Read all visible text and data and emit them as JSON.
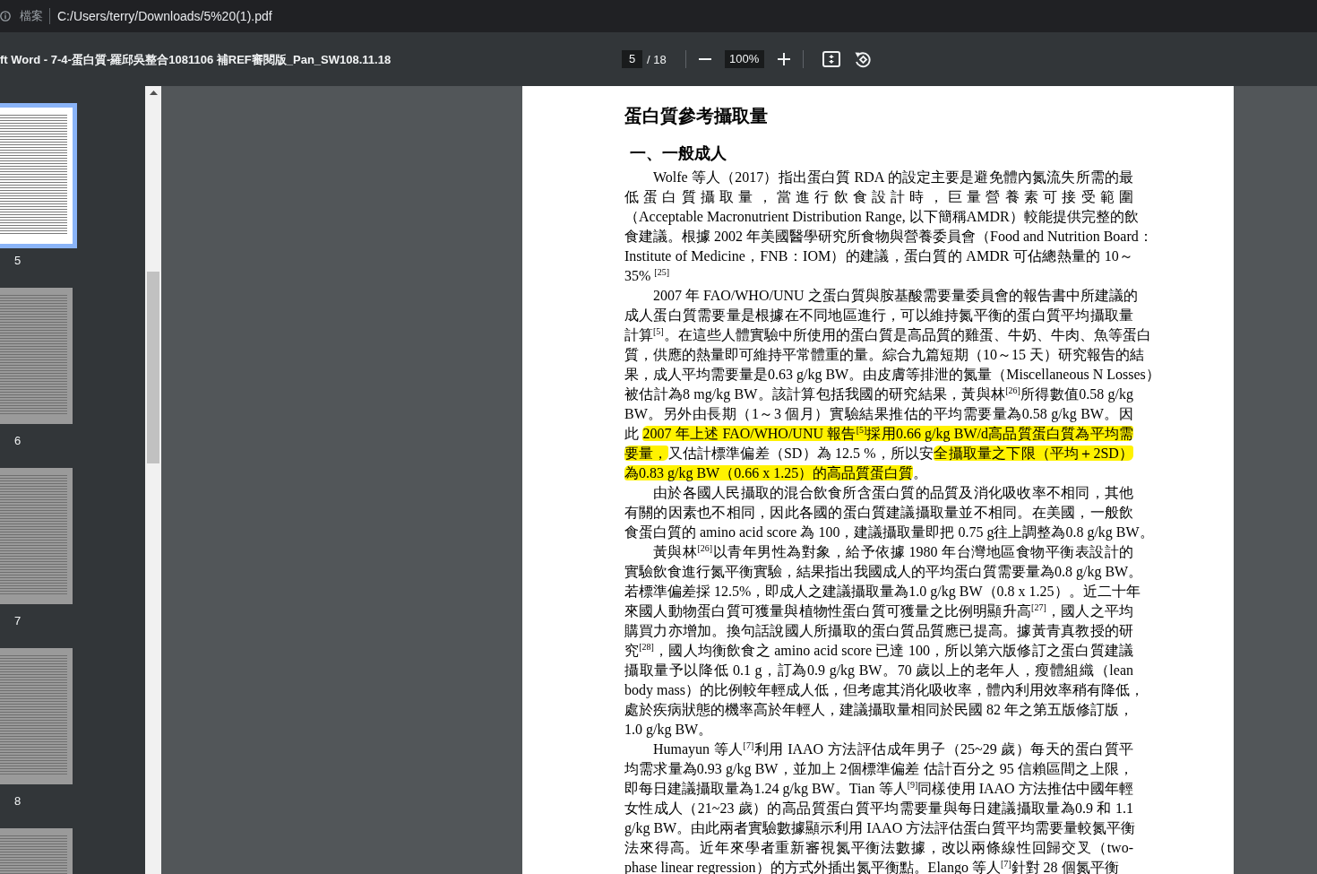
{
  "address_bar": {
    "scheme_label": "檔案",
    "url": "C:/Users/terry/Downloads/5%20(1).pdf"
  },
  "toolbar": {
    "title": "ft Word - 7-4-蛋白質-羅邱吳整合1081106 補REF審閱版_Pan_SW108.11.18",
    "page_number": "5",
    "page_total": "/ 18",
    "zoom": "100%"
  },
  "thumbnails": [
    {
      "label": "5",
      "selected": true
    },
    {
      "label": "6",
      "selected": false
    },
    {
      "label": "7",
      "selected": false
    },
    {
      "label": "8",
      "selected": false
    },
    {
      "selected": false
    }
  ],
  "document": {
    "title": "蛋白質參考攝取量",
    "heading": "一、一般成人",
    "paragraphs": [
      {
        "lines": [
          [
            {
              "text": "Wolfe 等人（2017）指出蛋白質 RDA 的設定主要是避免體內氮流失所需的最",
              "highlighted": false
            }
          ],
          [
            {
              "text": "低蛋白質攝取量，當進行飲食設計時，巨量營養素可接受範圍",
              "highlighted": false
            }
          ],
          [
            {
              "text": "（Acceptable Macronutrient Distribution Range, 以下簡稱AMDR）較能提供完整的飲",
              "highlighted": false
            }
          ],
          [
            {
              "text": "食建議。根據 2002 年美國醫學研究所食物與營養委員會（Food and Nutrition Board：",
              "highlighted": false
            }
          ],
          [
            {
              "text": "Institute of Medicine，FNB：IOM）的建議，蛋白質的 AMDR 可佔總熱量的 10～",
              "highlighted": false
            }
          ],
          [
            {
              "text": "35% $^{[25]}$",
              "highlighted": false
            }
          ]
        ]
      },
      {
        "lines": [
          [
            {
              "text": "2007 年 FAO/WHO/UNU 之蛋白質與胺基酸需要量委員會的報告書中所建議的",
              "highlighted": false
            }
          ],
          [
            {
              "text": "成人蛋白質需要量是根據在不同地區進行，可以維持氮平衡的蛋白質平均攝取量",
              "highlighted": false
            }
          ],
          [
            {
              "text": "計算$^{[5]}$。在這些人體實驗中所使用的蛋白質是高品質的雞蛋、牛奶、牛肉、魚等蛋白",
              "highlighted": false
            }
          ],
          [
            {
              "text": "質，供應的熱量即可維持平常體重的量。綜合九篇短期（10～15 天）研究報告的結",
              "highlighted": false
            }
          ],
          [
            {
              "text": "果，成人平均需要量是0.63 g/kg BW。由皮膚等排泄的氮量（Miscellaneous N Losses）",
              "highlighted": false
            }
          ],
          [
            {
              "text": "被估計為8 mg/kg BW。該計算包括我國的研究結果，黃與林$^{[26]}$所得數值0.58 g/kg",
              "highlighted": false
            }
          ],
          [
            {
              "text": "BW。另外由長期（1～3 個月）實驗結果推估的平均需要量為0.58 g/kg BW。因",
              "highlighted": false
            }
          ],
          [
            {
              "text": "此 ",
              "highlighted": false
            },
            {
              "text": "2007 年上述 FAO/WHO/UNU 報告$^{[5]}$採用0.66 g/kg BW/d高品質蛋白質為平均需",
              "highlighted": true
            }
          ],
          [
            {
              "text": "要量，",
              "highlighted": true
            },
            {
              "text": "又估計標準偏差（SD）為 12.5 %，所以安",
              "highlighted": false
            },
            {
              "text": "全攝取量之下限（平均＋2SD）",
              "highlighted": true
            }
          ],
          [
            {
              "text": "為0.83 g/kg BW（0.66 x 1.25）的高品質蛋白質",
              "highlighted": true
            },
            {
              "text": "。",
              "highlighted": false
            }
          ]
        ]
      },
      {
        "lines": [
          [
            {
              "text": "由於各國人民攝取的混合飲食所含蛋白質的品質及消化吸收率不相同，其他",
              "highlighted": false
            }
          ],
          [
            {
              "text": "有關的因素也不相同，因此各國的蛋白質建議攝取量並不相同。在美國，一般飲",
              "highlighted": false
            }
          ],
          [
            {
              "text": "食蛋白質的 amino acid score 為 100，建議攝取量即把 0.75 g往上調整為0.8 g/kg BW。",
              "highlighted": false
            }
          ]
        ]
      },
      {
        "lines": [
          [
            {
              "text": "黃與林$^{[26]}$以青年男性為對象，給予依據 1980 年台灣地區食物平衡表設計的",
              "highlighted": false
            }
          ],
          [
            {
              "text": "實驗飲食進行氮平衡實驗，結果指出我國成人的平均蛋白質需要量為0.8 g/kg BW。",
              "highlighted": false
            }
          ],
          [
            {
              "text": "若標準偏差採 12.5%，即成人之建議攝取量為1.0 g/kg BW（0.8 x 1.25）。近二十年",
              "highlighted": false
            }
          ],
          [
            {
              "text": "來國人動物蛋白質可獲量與植物性蛋白質可獲量之比例明顯升高$^{[27]}$，國人之平均",
              "highlighted": false
            }
          ],
          [
            {
              "text": "購買力亦增加。換句話說國人所攝取的蛋白質品質應已提高。據黃青真教授的研",
              "highlighted": false
            }
          ],
          [
            {
              "text": "究$^{[28]}$，國人均衡飲食之 amino acid score 已達 100，所以第六版修訂之蛋白質建議",
              "highlighted": false
            }
          ],
          [
            {
              "text": "攝取量予以降低 0.1 g，訂為0.9 g/kg BW。70 歲以上的老年人，瘦體組織（lean",
              "highlighted": false
            }
          ],
          [
            {
              "text": "body mass）的比例較年輕成人低，但考慮其消化吸收率，體內利用效率稍有降低，",
              "highlighted": false
            }
          ],
          [
            {
              "text": "處於疾病狀態的機率高於年輕人，建議攝取量相同於民國 82 年之第五版修訂版，",
              "highlighted": false
            }
          ],
          [
            {
              "text": "1.0 g/kg BW。",
              "highlighted": false
            }
          ]
        ]
      },
      {
        "lines": [
          [
            {
              "text": "Humayun 等人$^{[7]}$利用 IAAO 方法評估成年男子（25~29 歲）每天的蛋白質平",
              "highlighted": false
            }
          ],
          [
            {
              "text": "均需求量為0.93 g/kg BW，並加上 2個標準偏差 估計百分之 95 信賴區間之上限，",
              "highlighted": false
            }
          ],
          [
            {
              "text": "即每日建議攝取量為1.24 g/kg BW。Tian 等人$^{[9]}$同樣使用 IAAO 方法推估中國年輕",
              "highlighted": false
            }
          ],
          [
            {
              "text": "女性成人（21~23 歲）的高品質蛋白質平均需要量與每日建議攝取量為0.9 和 1.1",
              "highlighted": false
            }
          ],
          [
            {
              "text": "g/kg BW。由此兩者實驗數據顯示利用 IAAO 方法評估蛋白質平均需要量較氮平衡",
              "highlighted": false
            }
          ],
          [
            {
              "text": "法來得高。近年來學者重新審視氮平衡法數據，改以兩條線性回歸交叉（two-",
              "highlighted": false
            }
          ],
          [
            {
              "text": "phase linear regression）的方式外插出氮平衡點。Elango 等人$^{[7]}$針對 28 個氮平衡",
              "highlighted": false
            }
          ]
        ]
      }
    ]
  }
}
